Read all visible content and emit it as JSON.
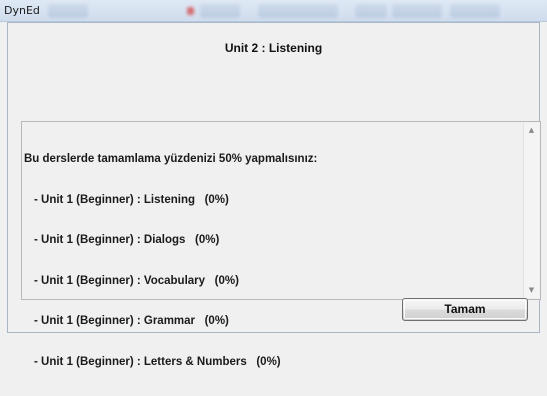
{
  "app": {
    "title": "DynEd"
  },
  "dialog": {
    "heading": "Unit 2 : Listening",
    "message": "Bu derslerde tamamlama yüzdenizi 50% yapmalısınız:",
    "items": [
      "- Unit 1 (Beginner) : Listening   (0%)",
      "- Unit 1 (Beginner) : Dialogs   (0%)",
      "- Unit 1 (Beginner) : Vocabulary   (0%)",
      "- Unit 1 (Beginner) : Grammar   (0%)",
      "- Unit 1 (Beginner) : Letters & Numbers   (0%)"
    ],
    "ok_label": "Tamam"
  },
  "icons": {
    "scroll_up": "chevron-up-icon",
    "scroll_down": "chevron-down-icon"
  }
}
